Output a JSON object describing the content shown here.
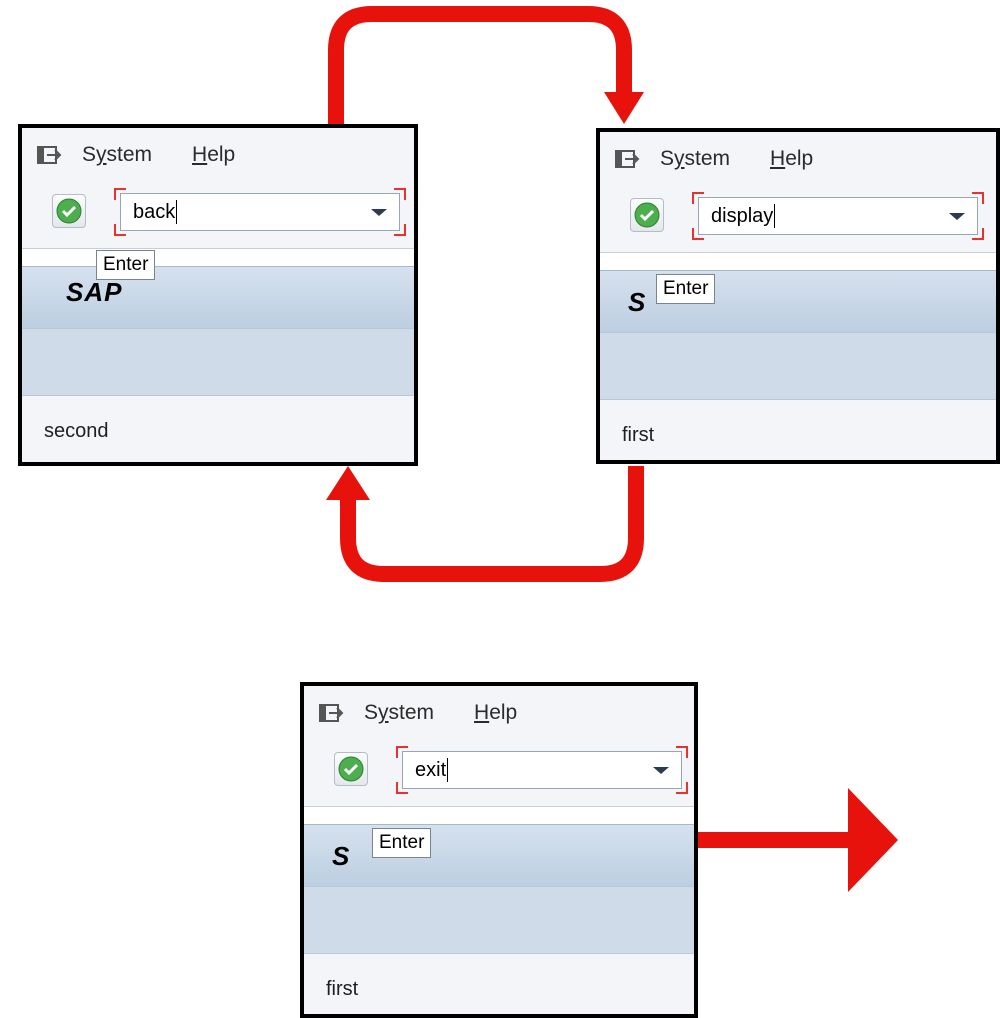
{
  "colors": {
    "arrow": "#e8120c",
    "accent_red": "#e8322e",
    "ok_green": "#4cae4c"
  },
  "windows": [
    {
      "menu": {
        "system": "System",
        "help": "Help"
      },
      "command": "back",
      "tooltip": "Enter",
      "logo": "SAP",
      "content": "second"
    },
    {
      "menu": {
        "system": "System",
        "help": "Help"
      },
      "command": "display",
      "tooltip": "Enter",
      "logo": "S",
      "content": "first"
    },
    {
      "menu": {
        "system": "System",
        "help": "Help"
      },
      "command": "exit",
      "tooltip": "Enter",
      "logo": "S",
      "content": "first"
    }
  ],
  "icons": [
    "exit-menu-icon",
    "ok-check-icon",
    "dropdown-arrow-icon",
    "flow-arrow-icon"
  ]
}
